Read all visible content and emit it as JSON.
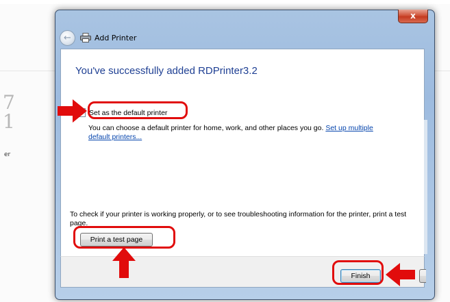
{
  "background": {
    "big_text": "7\n1",
    "small_text": "er"
  },
  "window": {
    "close_label": "x",
    "title": "Add Printer"
  },
  "dialog": {
    "heading": "You've successfully added RDPrinter3.2",
    "checkbox_label": "Set as the default printer",
    "checkbox_checked": false,
    "description": "You can choose a default printer for home, work, and other places you go.",
    "description_link": "Set up multiple default printers...",
    "info_text": "To check if your printer is working properly, or to see troubleshooting information for the printer, print a test page.",
    "print_test_label": "Print a test page"
  },
  "footer": {
    "finish_label": "Finish",
    "cancel_label": ""
  },
  "colors": {
    "annotation_red": "#e10c0c",
    "heading_blue": "#1e3f93",
    "link_blue": "#0645ad"
  }
}
